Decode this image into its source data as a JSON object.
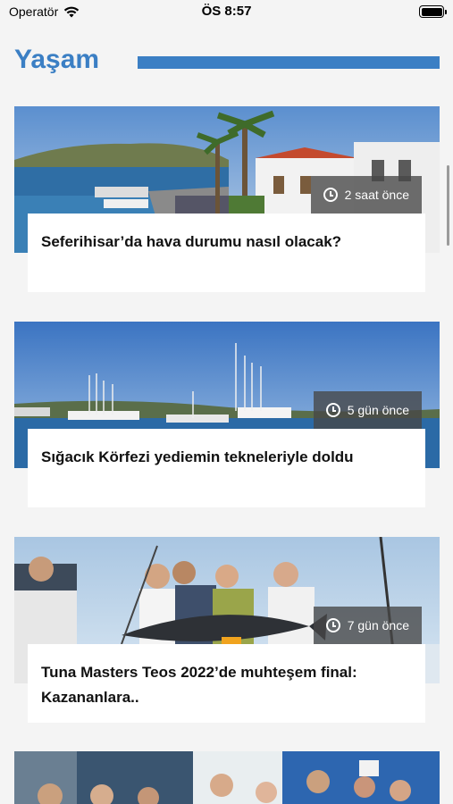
{
  "status_bar": {
    "carrier": "Operatör",
    "time": "ÖS 8:57"
  },
  "section": {
    "title": "Yaşam"
  },
  "articles": [
    {
      "title": "Seferihisar’da hava durumu nasıl olacak?",
      "time_ago": "2 saat önce"
    },
    {
      "title": "Sığacık Körfezi yediemin tekneleriyle doldu",
      "time_ago": "5 gün önce"
    },
    {
      "title": "Tuna Masters Teos 2022’de muhteşem final: Kazananlara..",
      "time_ago": "7 gün önce"
    }
  ],
  "icons": {
    "wifi": "wifi-icon",
    "battery": "battery-icon",
    "clock": "clock-icon"
  },
  "colors": {
    "accent": "#3b7fc4",
    "background": "#f4f4f4"
  }
}
